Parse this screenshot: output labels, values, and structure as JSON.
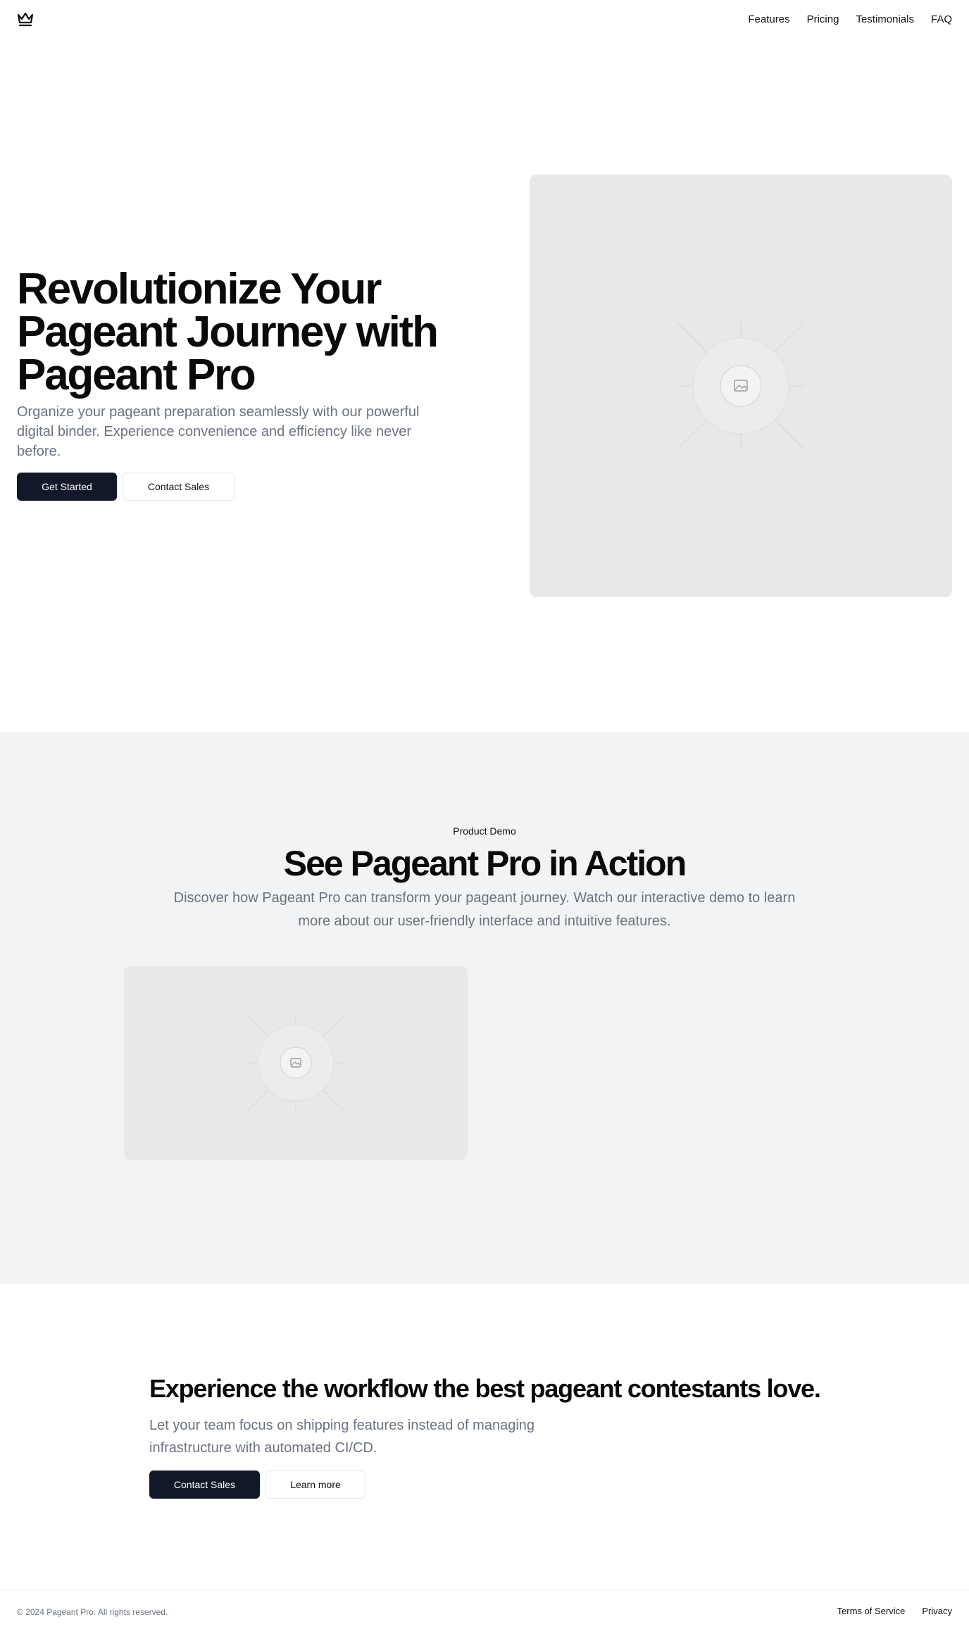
{
  "header": {
    "logo_icon": "crown-icon",
    "nav": [
      "Features",
      "Pricing",
      "Testimonials",
      "FAQ"
    ]
  },
  "hero": {
    "title": "Revolutionize Your Pageant Journey with Pageant Pro",
    "subtitle": "Organize your pageant preparation seamlessly with our powerful digital binder. Experience convenience and efficiency like never before.",
    "primary_button": "Get Started",
    "secondary_button": "Contact Sales",
    "image_icon": "image-placeholder-icon"
  },
  "demo": {
    "kicker": "Product Demo",
    "title": "See Pageant Pro in Action",
    "subtitle": "Discover how Pageant Pro can transform your pageant journey. Watch our interactive demo to learn more about our user-friendly interface and intuitive features.",
    "image_icon": "image-placeholder-icon"
  },
  "cta": {
    "title": "Experience the workflow the best pageant contestants love.",
    "subtitle": "Let your team focus on shipping features instead of managing infrastructure with automated CI/CD.",
    "primary_button": "Contact Sales",
    "secondary_button": "Learn more"
  },
  "footer": {
    "copyright": "© 2024 Pageant Pro. All rights reserved.",
    "links": [
      "Terms of Service",
      "Privacy"
    ]
  },
  "colors": {
    "primary_button_bg": "#111827",
    "muted_text": "#6b7280",
    "section_bg": "#f2f3f5",
    "placeholder_bg": "#e8e8e8"
  }
}
